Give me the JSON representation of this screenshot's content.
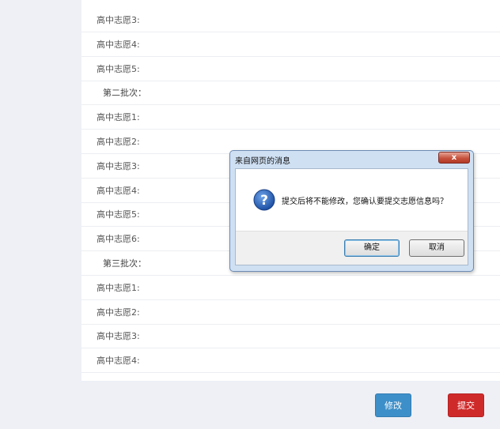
{
  "form": {
    "rows": [
      {
        "label": "高中志愿3:",
        "type": "field"
      },
      {
        "label": "高中志愿4:",
        "type": "field"
      },
      {
        "label": "高中志愿5:",
        "type": "field"
      },
      {
        "label": "第二批次：",
        "type": "section"
      },
      {
        "label": "高中志愿1:",
        "type": "field"
      },
      {
        "label": "高中志愿2:",
        "type": "field"
      },
      {
        "label": "高中志愿3:",
        "type": "field"
      },
      {
        "label": "高中志愿4:",
        "type": "field"
      },
      {
        "label": "高中志愿5:",
        "type": "field"
      },
      {
        "label": "高中志愿6:",
        "type": "field"
      },
      {
        "label": "第三批次：",
        "type": "section"
      },
      {
        "label": "高中志愿1:",
        "type": "field"
      },
      {
        "label": "高中志愿2:",
        "type": "field"
      },
      {
        "label": "高中志愿3:",
        "type": "field"
      },
      {
        "label": "高中志愿4:",
        "type": "field"
      }
    ]
  },
  "actions": {
    "modify_label": "修改",
    "submit_label": "提交",
    "modify_color": "#3d8fc9",
    "submit_color": "#cf2a2a"
  },
  "dialog": {
    "title": "来自网页的消息",
    "close_glyph": "x",
    "icon": "question-icon",
    "message": "提交后将不能修改，您确认要提交志愿信息吗？",
    "ok_label": "确定",
    "cancel_label": "取消"
  }
}
